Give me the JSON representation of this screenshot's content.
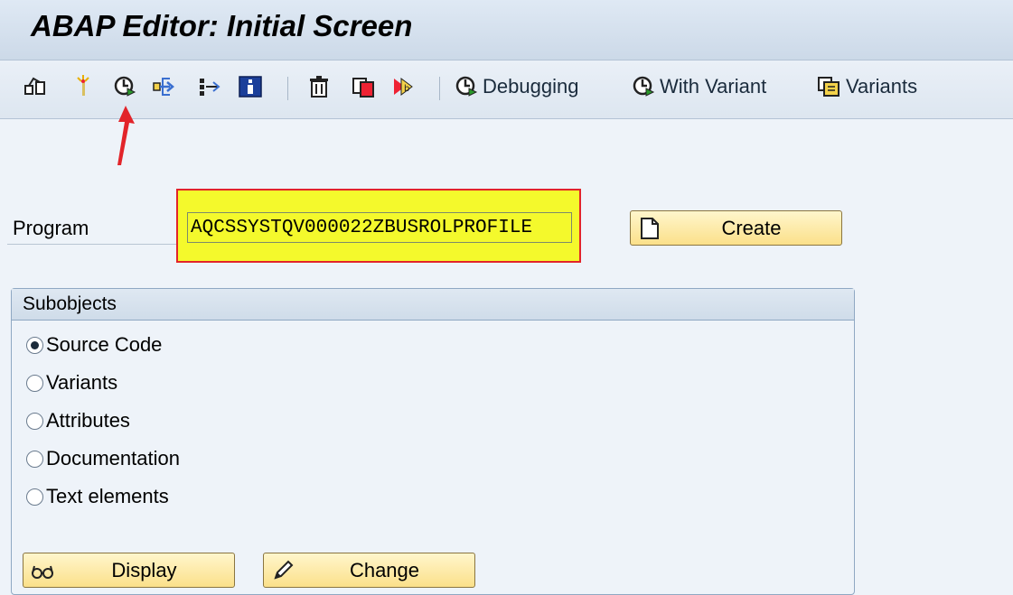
{
  "window": {
    "title": "ABAP Editor: Initial Screen"
  },
  "toolbar": {
    "icons": [
      "other-object-icon",
      "new-object-icon",
      "execute-icon",
      "where-used-icon",
      "back-in-list-icon",
      "information-icon",
      "delete-icon",
      "copy-icon",
      "rename-icon"
    ],
    "debugging_label": "Debugging",
    "with_variant_label": "With Variant",
    "variants_label": "Variants"
  },
  "program": {
    "label": "Program",
    "value": "AQCSSYSTQV000022ZBUSROLPROFILE"
  },
  "create_button": {
    "label": "Create"
  },
  "subobjects": {
    "title": "Subobjects",
    "options": [
      {
        "label": "Source Code",
        "selected": true
      },
      {
        "label": "Variants",
        "selected": false
      },
      {
        "label": "Attributes",
        "selected": false
      },
      {
        "label": "Documentation",
        "selected": false
      },
      {
        "label": "Text elements",
        "selected": false
      }
    ]
  },
  "actions": {
    "display_label": "Display",
    "change_label": "Change"
  },
  "colors": {
    "highlight": "#f4f92c",
    "highlight_border": "#e2242a",
    "annotation_arrow": "#e2242a",
    "button_fill": "#fbe08a"
  }
}
